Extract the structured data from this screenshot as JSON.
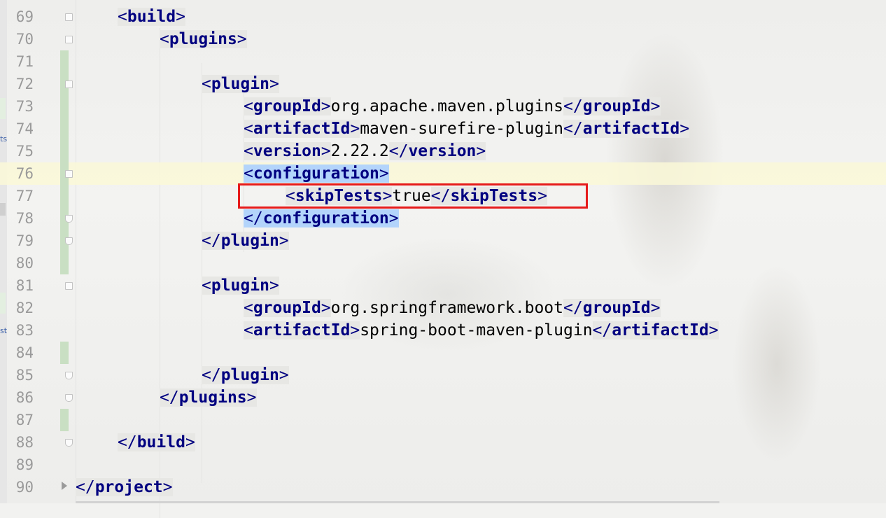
{
  "editor": {
    "lines": [
      {
        "num": "69",
        "indent": 1,
        "parts": [
          {
            "t": "tag",
            "v": "<build>"
          }
        ]
      },
      {
        "num": "70",
        "indent": 2,
        "parts": [
          {
            "t": "tag",
            "v": "<plugins>"
          }
        ]
      },
      {
        "num": "71",
        "indent": 0,
        "parts": []
      },
      {
        "num": "72",
        "indent": 3,
        "parts": [
          {
            "t": "tag",
            "v": "<plugin>"
          }
        ]
      },
      {
        "num": "73",
        "indent": 4,
        "parts": [
          {
            "t": "tag",
            "v": "<groupId>"
          },
          {
            "t": "text",
            "v": "org.apache.maven.plugins"
          },
          {
            "t": "tag",
            "v": "</groupId>"
          }
        ]
      },
      {
        "num": "74",
        "indent": 4,
        "parts": [
          {
            "t": "tag",
            "v": "<artifactId>"
          },
          {
            "t": "text",
            "v": "maven-surefire-plugin"
          },
          {
            "t": "tag",
            "v": "</artifactId>"
          }
        ]
      },
      {
        "num": "75",
        "indent": 4,
        "parts": [
          {
            "t": "tag",
            "v": "<version>"
          },
          {
            "t": "text",
            "v": "2.22.2"
          },
          {
            "t": "tag",
            "v": "</version>"
          }
        ]
      },
      {
        "num": "76",
        "indent": 4,
        "parts": [
          {
            "t": "tag",
            "v": "<configuration>",
            "hl": true
          }
        ]
      },
      {
        "num": "77",
        "indent": 5,
        "parts": [
          {
            "t": "tag",
            "v": "<skipTests>"
          },
          {
            "t": "text",
            "v": "true"
          },
          {
            "t": "tag",
            "v": "</skipTests>"
          }
        ]
      },
      {
        "num": "78",
        "indent": 4,
        "parts": [
          {
            "t": "tag",
            "v": "</configuration>",
            "hl": true
          }
        ]
      },
      {
        "num": "79",
        "indent": 3,
        "parts": [
          {
            "t": "tag",
            "v": "</plugin>"
          }
        ]
      },
      {
        "num": "80",
        "indent": 0,
        "parts": []
      },
      {
        "num": "81",
        "indent": 3,
        "parts": [
          {
            "t": "tag",
            "v": "<plugin>"
          }
        ]
      },
      {
        "num": "82",
        "indent": 4,
        "parts": [
          {
            "t": "tag",
            "v": "<groupId>"
          },
          {
            "t": "text",
            "v": "org.springframework.boot"
          },
          {
            "t": "tag",
            "v": "</groupId>"
          }
        ]
      },
      {
        "num": "83",
        "indent": 4,
        "parts": [
          {
            "t": "tag",
            "v": "<artifactId>"
          },
          {
            "t": "text",
            "v": "spring-boot-maven-plugin"
          },
          {
            "t": "tag",
            "v": "</artifactId>"
          }
        ]
      },
      {
        "num": "84",
        "indent": 0,
        "parts": []
      },
      {
        "num": "85",
        "indent": 3,
        "parts": [
          {
            "t": "tag",
            "v": "</plugin>"
          }
        ]
      },
      {
        "num": "86",
        "indent": 2,
        "parts": [
          {
            "t": "tag",
            "v": "</plugins>"
          }
        ]
      },
      {
        "num": "87",
        "indent": 0,
        "parts": []
      },
      {
        "num": "88",
        "indent": 1,
        "parts": [
          {
            "t": "tag",
            "v": "</build>"
          }
        ]
      },
      {
        "num": "89",
        "indent": 0,
        "parts": []
      },
      {
        "num": "90",
        "indent": 0,
        "parts": [
          {
            "t": "tag",
            "v": "</project>"
          }
        ]
      }
    ]
  },
  "left_panel": {
    "label_top": "ts",
    "label_bottom": "st"
  },
  "colors": {
    "tag": "#000080",
    "text": "#000000",
    "highlight": "#b3d4fb",
    "current_line": "#faf8d7",
    "annotation_box": "#e61b1b"
  }
}
